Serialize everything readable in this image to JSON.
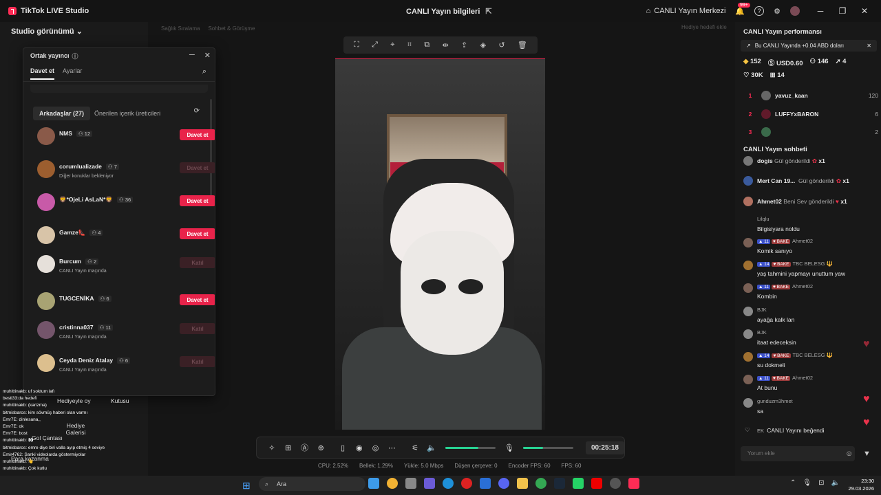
{
  "titlebar": {
    "app_name": "TikTok LIVE Studio",
    "center": "CANLI Yayın bilgileri",
    "live_center": "CANLI Yayın Merkezi",
    "notif_badge": "99+"
  },
  "studio": {
    "title": "Studio görünümü",
    "bg_tab1": "Sağlık Sıralama",
    "bg_tab2": "Sohbet & Görüşme",
    "bg_gift": "Hediye hedefi ekle"
  },
  "modal": {
    "title": "Ortak yayıncı",
    "tab_invite": "Davet et",
    "tab_settings": "Ayarlar",
    "friends_tab": "Arkadaşlar (27)",
    "suggested_tab": "Önerilen içerik üreticileri"
  },
  "friends": [
    {
      "name": "NMS",
      "count": "12",
      "sub": "",
      "btn": "Davet et",
      "active": true
    },
    {
      "name": "corumlualizade",
      "count": "7",
      "sub": "Diğer konuklar bekleniyor",
      "btn": "Davet et",
      "active": false
    },
    {
      "name": "🦁*OjeLi AsLaN*🦁",
      "count": "36",
      "sub": "",
      "btn": "Davet et",
      "active": true
    },
    {
      "name": "Gamze👠",
      "count": "4",
      "sub": "",
      "btn": "Davet et",
      "active": true
    },
    {
      "name": "Burcum",
      "count": "2",
      "sub": "CANLI Yayın maçında",
      "btn": "Katıl",
      "active": false
    },
    {
      "name": "TUGCENİKA",
      "count": "6",
      "sub": "",
      "btn": "Davet et",
      "active": true
    },
    {
      "name": "cristinna037",
      "count": "11",
      "sub": "CANLI Yayın maçında",
      "btn": "Katıl",
      "active": false
    },
    {
      "name": "Ceyda Deniz Atalay",
      "count": "6",
      "sub": "CANLI Yayın maçında",
      "btn": "Katıl",
      "active": false
    }
  ],
  "tools": {
    "gift_vote": "Hediyeyle oy",
    "box": "Kutusu",
    "gift_gallery": "Hediye Galerisi",
    "quest": "Para kazanma",
    "goal": "Gol Çantası"
  },
  "chatlog": [
    "muhittinakb: uf soktum lafı",
    "besti33:da hedefi",
    "muhittinakb: (karizma)",
    "bitmisbaros: kim sövmüş haberi olan varmı",
    "Emr7E: dinlesana,,",
    "Emr7E: ok",
    "Emr7E: bost",
    "muhittinakb: 👀",
    "bitmisbaros: emre diye biri valla ayıp etmiş 4 seviye",
    "Emir4762: Sanki videolarda göstermiyolar",
    "muhittinakb: 👋",
    "muhittinakb: Çok kutlu"
  ],
  "controls": {
    "timer": "00:25:18"
  },
  "stats": [
    "CPU: 2.52%",
    "Bellek: 1.29%",
    "Yükle: 5.0 Mbps",
    "Düşen çerçeve: 0",
    "Encoder FPS: 60",
    "FPS: 60"
  ],
  "perf": {
    "title": "CANLI Yayın performansı",
    "banner": "Bu CANLI Yayında +0.04 ABD doları",
    "diamonds": "152",
    "usd": "USD0.60",
    "viewers": "146",
    "shares": "4",
    "likes": "30K",
    "gifters": "14"
  },
  "ranking": [
    {
      "rank": "1",
      "name": "yavuz_kaan",
      "val": "120"
    },
    {
      "rank": "2",
      "name": "LUFFYxBARON",
      "val": "6"
    },
    {
      "rank": "3",
      "name": "",
      "val": "2"
    }
  ],
  "chat": {
    "title": "CANLI Yayın sohbeti",
    "placeholder": "Yorum ekle"
  },
  "gifts": [
    {
      "name": "dogis",
      "txt": "Gül gönderildi",
      "x": "x1"
    },
    {
      "name": "Mert Can 19...",
      "txt": "Gül gönderildi",
      "x": "x1"
    },
    {
      "name": "Ahmet02",
      "txt": "Beni Sev gönderildi",
      "x": "x1"
    }
  ],
  "messages": [
    {
      "name": "Lilqlu",
      "txt": "Bilgisiyara noldu",
      "lvl": "",
      "team": ""
    },
    {
      "name": "Ahmet02",
      "txt": "Komik sanıyo",
      "lvl": "11",
      "team": "BAKE"
    },
    {
      "name": "TBC BELESG 🔱",
      "txt": "yaş tahmini yapmayı unuttum yaw",
      "lvl": "14",
      "team": "BAKE"
    },
    {
      "name": "Ahmet02",
      "txt": "Kombin",
      "lvl": "11",
      "team": "BAKE"
    },
    {
      "name": "BJK",
      "txt": "ayağa kalk lan",
      "lvl": "",
      "team": ""
    },
    {
      "name": "BJK",
      "txt": "itaat edeceksin",
      "lvl": "",
      "team": ""
    },
    {
      "name": "TBC BELESG 🔱",
      "txt": "su dokmeli",
      "lvl": "14",
      "team": "BAKE"
    },
    {
      "name": "Ahmet02",
      "txt": "At bunu",
      "lvl": "11",
      "team": "BAKE"
    },
    {
      "name": "gunduzm3hmet",
      "txt": "sa",
      "lvl": "",
      "team": ""
    }
  ],
  "liked": {
    "name": "EK",
    "txt": "CANLI Yayını beğendi"
  },
  "taskbar": {
    "search": "Ara",
    "time": "23:30",
    "date": "29.03.2026"
  }
}
